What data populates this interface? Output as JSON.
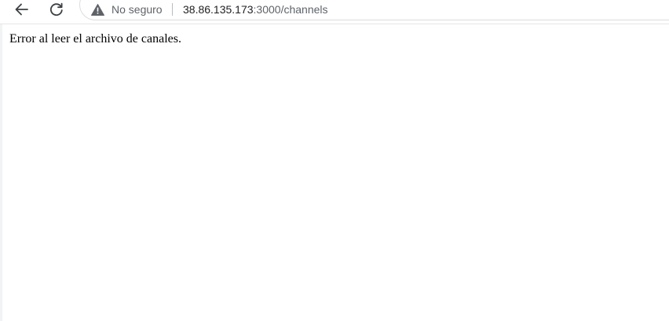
{
  "toolbar": {
    "back_icon": "back-arrow-icon",
    "reload_icon": "reload-icon"
  },
  "address_bar": {
    "security_icon": "warning-triangle-icon",
    "security_label": "No seguro",
    "url_host": "38.86.135.173",
    "url_path": ":3000/channels"
  },
  "page": {
    "message": "Error al leer el archivo de canales."
  }
}
